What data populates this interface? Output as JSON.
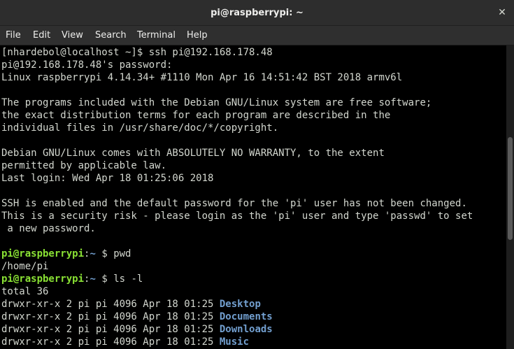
{
  "window": {
    "title": "pi@raspberrypi: ~",
    "close_glyph": "✕"
  },
  "menu": [
    "File",
    "Edit",
    "View",
    "Search",
    "Terminal",
    "Help"
  ],
  "terminal": {
    "lines": [
      "[nhardebol@localhost ~]$ ssh pi@192.168.178.48",
      "pi@192.168.178.48's password:",
      "Linux raspberrypi 4.14.34+ #1110 Mon Apr 16 14:51:42 BST 2018 armv6l",
      "",
      "The programs included with the Debian GNU/Linux system are free software;",
      "the exact distribution terms for each program are described in the",
      "individual files in /usr/share/doc/*/copyright.",
      "",
      "Debian GNU/Linux comes with ABSOLUTELY NO WARRANTY, to the extent",
      "permitted by applicable law.",
      "Last login: Wed Apr 18 01:25:06 2018",
      "",
      "SSH is enabled and the default password for the 'pi' user has not been changed.",
      "This is a security risk - please login as the 'pi' user and type 'passwd' to set",
      " a new password.",
      ""
    ],
    "prompt_user": "pi@raspberrypi",
    "prompt_sep": ":",
    "prompt_path": "~",
    "prompt_symbol": " $ ",
    "cmd_pwd": "pwd",
    "pwd_output": "/home/pi",
    "cmd_ls": "ls -l",
    "total": "total 36",
    "listing": [
      {
        "meta": "drwxr-xr-x 2 pi pi 4096 Apr 18 01:25 ",
        "name": "Desktop"
      },
      {
        "meta": "drwxr-xr-x 2 pi pi 4096 Apr 18 01:25 ",
        "name": "Documents"
      },
      {
        "meta": "drwxr-xr-x 2 pi pi 4096 Apr 18 01:25 ",
        "name": "Downloads"
      },
      {
        "meta": "drwxr-xr-x 2 pi pi 4096 Apr 18 01:25 ",
        "name": "Music"
      }
    ]
  }
}
